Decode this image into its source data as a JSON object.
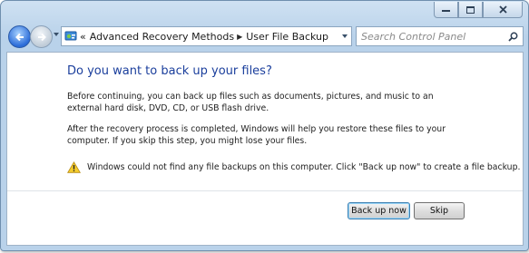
{
  "window": {
    "controls": [
      "minimize",
      "maximize",
      "close"
    ]
  },
  "navbar": {
    "breadcrumb_prefix": "«",
    "breadcrumb": [
      "Advanced Recovery Methods",
      "User File Backup"
    ],
    "search_placeholder": "Search Control Panel"
  },
  "main": {
    "heading": "Do you want to back up your files?",
    "para1": "Before continuing, you can back up files such as documents, pictures, and music to an external hard disk, DVD, CD, or USB flash drive.",
    "para2": "After the recovery process is completed, Windows will help you restore these files to  your computer.  If you skip this step, you might lose your files.",
    "warning": "Windows could not find any file backups on this computer. Click \"Back up now\" to create a file backup."
  },
  "buttons": {
    "backup": "Back up now",
    "skip": "Skip"
  },
  "colors": {
    "heading": "#1a3e9c",
    "frame": "#b9d2ea",
    "primary_button_border": "#3c7fb1"
  }
}
